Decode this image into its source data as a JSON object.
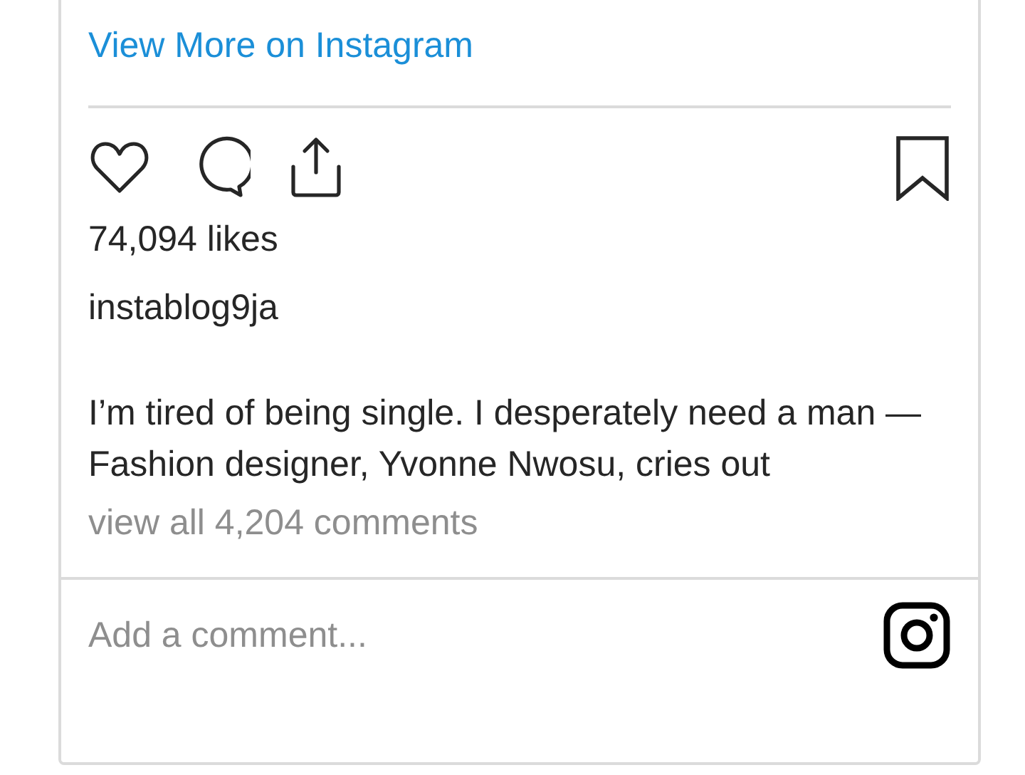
{
  "link": "View More on Instagram",
  "actions": [
    {
      "kind": "like"
    },
    {
      "kind": "comment"
    },
    {
      "kind": "share"
    },
    {
      "kind": "save"
    }
  ],
  "likes": "74,094 likes",
  "username": "instablog9ja",
  "caption": "I’m tired of being single. I desperately need a man — Fashion designer, Yvonne Nwosu, cries out",
  "comments_link": "view all 4,204 comments",
  "comment_field": {
    "placeholder": "Add a comment..."
  }
}
